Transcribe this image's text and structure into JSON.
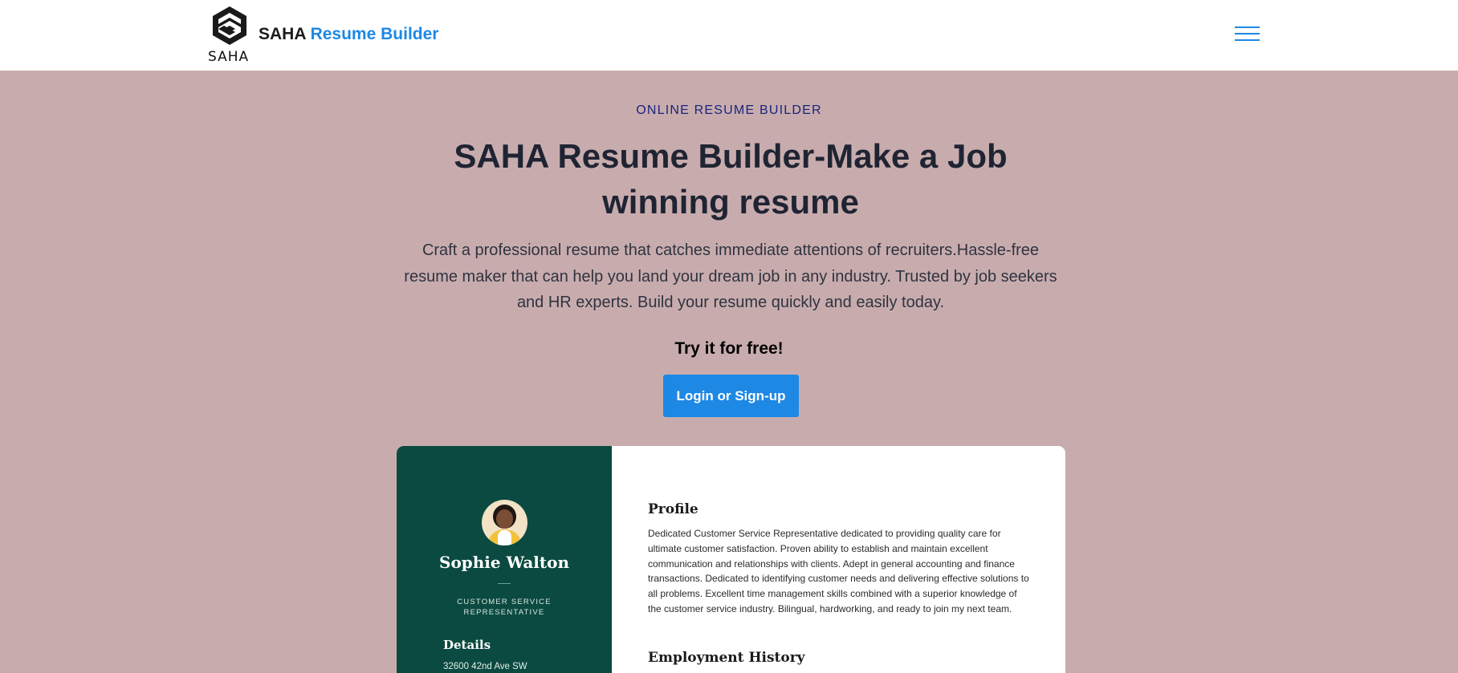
{
  "navbar": {
    "logo_text": "SAHA",
    "brand_primary": "SAHA",
    "brand_accent": "Resume Builder",
    "menu_icon": "hamburger-menu-icon"
  },
  "hero": {
    "eyebrow": "ONLINE RESUME BUILDER",
    "title": "SAHA Resume Builder-Make a Job winning resume",
    "description": "Craft a professional resume that catches immediate attentions of recruiters.Hassle-free resume maker that can help you land your dream job in any industry. Trusted by job seekers and HR experts. Build your resume quickly and easily today.",
    "try_free": "Try it for free!",
    "cta_label": "Login or Sign-up"
  },
  "resume_preview": {
    "name": "Sophie Walton",
    "role": "CUSTOMER SERVICE REPRESENTATIVE",
    "details_heading": "Details",
    "address": "32600 42nd Ave SW",
    "profile_heading": "Profile",
    "profile_text": "Dedicated Customer Service Representative dedicated to providing quality care for ultimate customer satisfaction. Proven ability to establish and maintain excellent communication and relationships with clients. Adept in general accounting and finance transactions. Dedicated to identifying customer needs and delivering effective solutions to all problems. Excellent time management skills combined with a superior knowledge of the customer service industry. Bilingual, hardworking, and ready to join my next team.",
    "employment_heading": "Employment History"
  },
  "colors": {
    "background": "#c8acad",
    "accent": "#1e88e5",
    "eyebrow": "#1a237e",
    "resume_sidebar": "#0b4a40"
  }
}
